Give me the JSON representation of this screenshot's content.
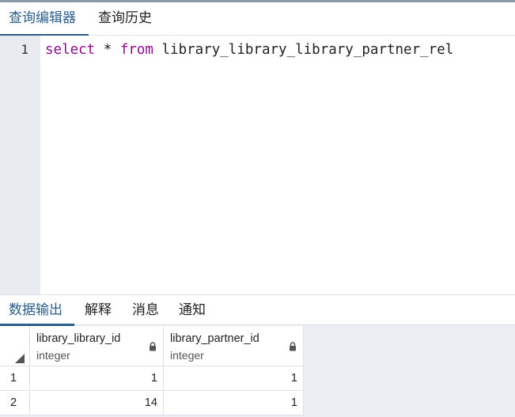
{
  "tabs": {
    "editor_label": "查询编辑器",
    "history_label": "查询历史"
  },
  "editor": {
    "line_number": "1",
    "code": {
      "kw_select": "select",
      "star": " * ",
      "kw_from": "from",
      "table": " library_library_library_partner_rel"
    }
  },
  "result_tabs": {
    "output": "数据输出",
    "explain": "解释",
    "messages": "消息",
    "notifications": "通知"
  },
  "table": {
    "columns": [
      {
        "name": "library_library_id",
        "type": "integer"
      },
      {
        "name": "library_partner_id",
        "type": "integer"
      }
    ],
    "rows": [
      {
        "num": "1",
        "values": [
          "1",
          "1"
        ]
      },
      {
        "num": "2",
        "values": [
          "14",
          "1"
        ]
      }
    ]
  },
  "colors": {
    "accent": "#2b5c8a",
    "keyword": "#8e0b8e",
    "gutter": "#e8ecf1"
  }
}
